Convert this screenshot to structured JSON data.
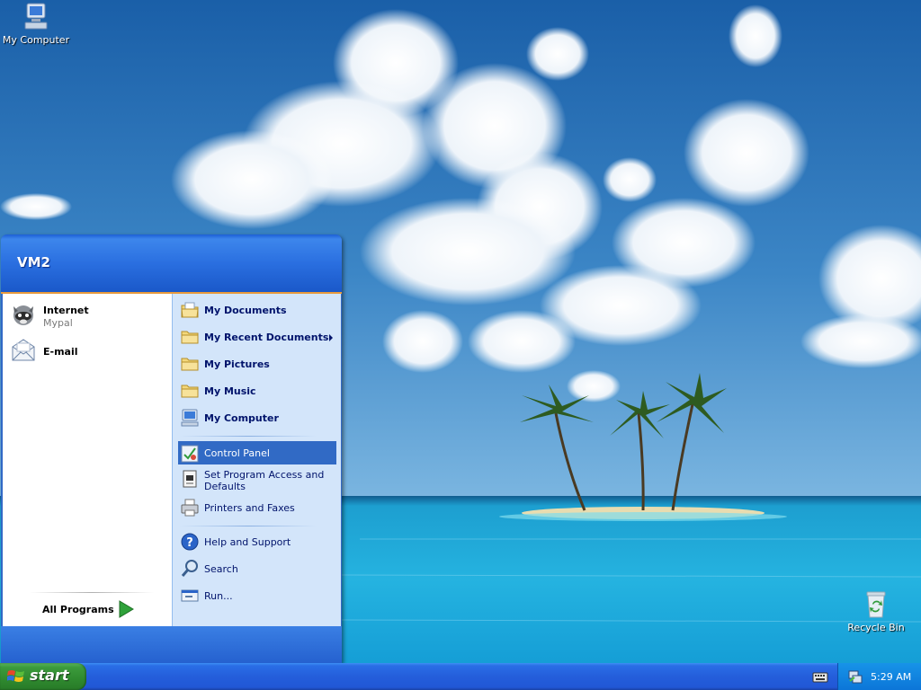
{
  "desktop": {
    "icons": [
      {
        "label": "My Computer"
      },
      {
        "label": "Recycle Bin"
      }
    ]
  },
  "start_menu": {
    "user_name": "VM2",
    "pinned": [
      {
        "title": "Internet",
        "subtitle": "Mypal",
        "icon": "raccoon-browser-icon"
      },
      {
        "title": "E-mail",
        "icon": "envelope-icon"
      }
    ],
    "all_programs_label": "All Programs",
    "places": [
      {
        "label": "My Documents",
        "icon": "my-documents-icon"
      },
      {
        "label": "My Recent Documents",
        "icon": "folder-icon",
        "has_submenu": true
      },
      {
        "label": "My Pictures",
        "icon": "folder-icon"
      },
      {
        "label": "My Music",
        "icon": "folder-icon"
      },
      {
        "label": "My Computer",
        "icon": "computer-icon"
      }
    ],
    "settings": [
      {
        "label": "Control Panel",
        "icon": "control-panel-icon",
        "selected": true
      },
      {
        "label": "Set Program Access and Defaults",
        "icon": "program-access-icon"
      },
      {
        "label": "Printers and Faxes",
        "icon": "printer-icon"
      }
    ],
    "utilities": [
      {
        "label": "Help and Support",
        "icon": "help-icon"
      },
      {
        "label": "Search",
        "icon": "search-icon"
      },
      {
        "label": "Run...",
        "icon": "run-icon"
      }
    ]
  },
  "taskbar": {
    "start_label": "start",
    "clock": "5:29 AM"
  },
  "colors": {
    "taskbar_blue": "#245edb",
    "start_green": "#3c9b3c",
    "selection_blue": "#316ac5",
    "menu_right_panel": "#d3e5fa"
  }
}
